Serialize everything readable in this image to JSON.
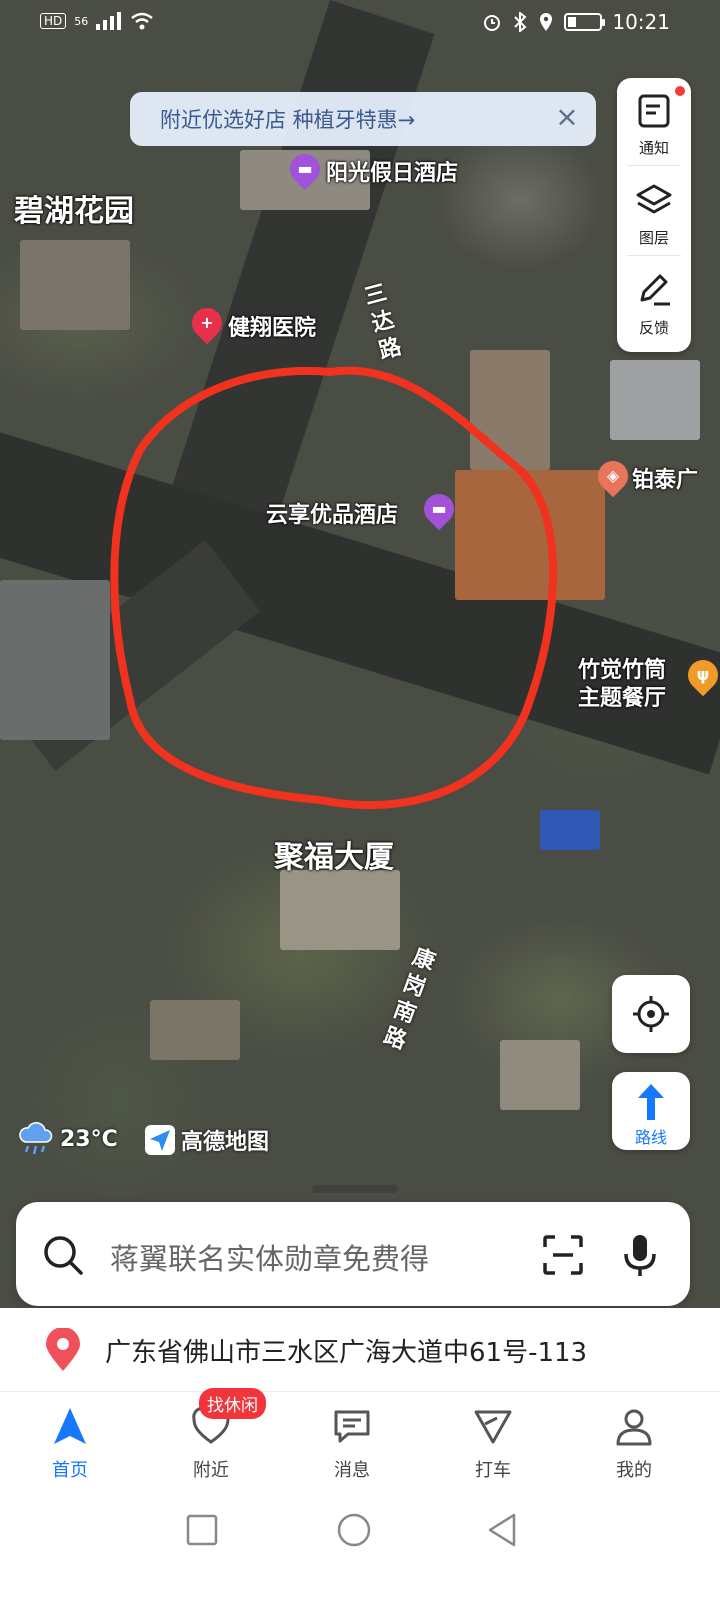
{
  "status_bar": {
    "network_left": "HD",
    "signal": "56",
    "time": "10:21",
    "battery_fraction": 0.25
  },
  "promo": {
    "text": "附近优选好店 种植牙特惠→"
  },
  "side_panel": {
    "items": [
      {
        "label": "通知",
        "icon": "notification-icon"
      },
      {
        "label": "图层",
        "icon": "layers-icon"
      },
      {
        "label": "反馈",
        "icon": "feedback-icon"
      }
    ]
  },
  "map_labels": {
    "bihu": "碧湖花园",
    "yangguang": "阳光假日酒店",
    "jianxiang": "健翔医院",
    "yunxiang": "云享优品酒店",
    "botai": "铂泰广",
    "zhujue_1": "竹觉竹筒",
    "zhujue_2": "主题餐厅",
    "jufu": "聚福大厦",
    "sanda_road": "三达路",
    "kanggang_road": "康岗南路"
  },
  "right_buttons": {
    "route_label": "路线"
  },
  "weather": {
    "temp": "23°C",
    "brand": "高德地图"
  },
  "search": {
    "placeholder": "蒋翼联名实体勋章免费得"
  },
  "address": {
    "text": "广东省佛山市三水区广海大道中61号-113"
  },
  "tabbar": {
    "badge": "找休闲",
    "tabs": [
      {
        "label": "首页",
        "icon": "home-navigate-icon",
        "active": true
      },
      {
        "label": "附近",
        "icon": "nearby-heart-icon",
        "active": false
      },
      {
        "label": "消息",
        "icon": "message-icon",
        "active": false
      },
      {
        "label": "打车",
        "icon": "taxi-icon",
        "active": false
      },
      {
        "label": "我的",
        "icon": "profile-icon",
        "active": false
      }
    ]
  },
  "colors": {
    "accent": "#1677ff",
    "circle": "#f0321e",
    "badge": "#f2353b"
  }
}
